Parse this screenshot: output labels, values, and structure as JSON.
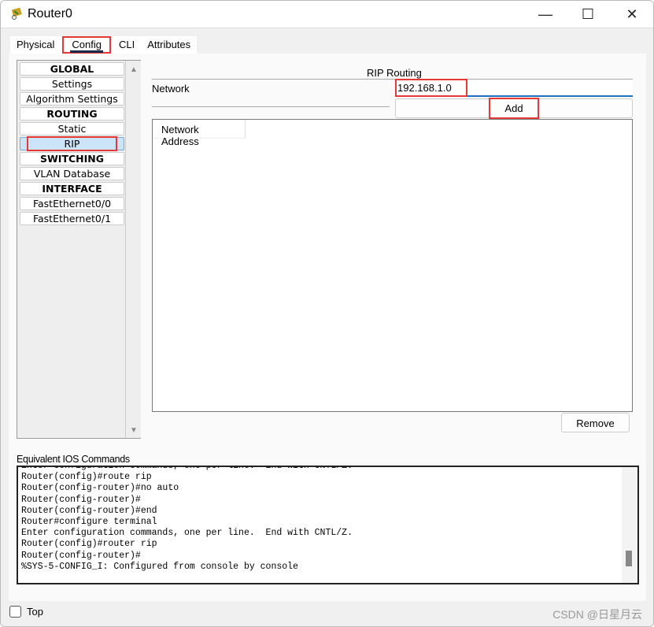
{
  "window": {
    "title": "Router0",
    "minimize": "—",
    "maximize": "☐",
    "close": "✕"
  },
  "tabs": [
    {
      "label": "Physical"
    },
    {
      "label": "Config"
    },
    {
      "label": "CLI"
    },
    {
      "label": "Attributes"
    }
  ],
  "nav": {
    "items": [
      {
        "label": "GLOBAL"
      },
      {
        "label": "Settings"
      },
      {
        "label": "Algorithm Settings"
      },
      {
        "label": "ROUTING"
      },
      {
        "label": "Static"
      },
      {
        "label": "RIP"
      },
      {
        "label": "SWITCHING"
      },
      {
        "label": "VLAN Database"
      },
      {
        "label": "INTERFACE"
      },
      {
        "label": "FastEthernet0/0"
      },
      {
        "label": "FastEthernet0/1"
      }
    ]
  },
  "rip": {
    "title": "RIP Routing",
    "network_label": "Network",
    "network_value": "192.168.1.0",
    "add_label": "Add",
    "column": "Network Address",
    "remove_label": "Remove"
  },
  "console": {
    "label": "Equivalent IOS Commands",
    "lines": [
      "Enter configuration commands, one per line.  End with CNTL/Z.",
      "Router(config)#route rip",
      "Router(config-router)#no auto",
      "Router(config-router)#",
      "Router(config-router)#end",
      "Router#configure terminal",
      "Enter configuration commands, one per line.  End with CNTL/Z.",
      "Router(config)#router rip",
      "Router(config-router)#",
      "%SYS-5-CONFIG_I: Configured from console by console"
    ]
  },
  "bottom": {
    "top_label": "Top",
    "watermark": "CSDN @日星月云"
  },
  "colors": {
    "highlight": "#e53935",
    "selected": "#cce4f7",
    "accent": "#1f6fbf"
  }
}
